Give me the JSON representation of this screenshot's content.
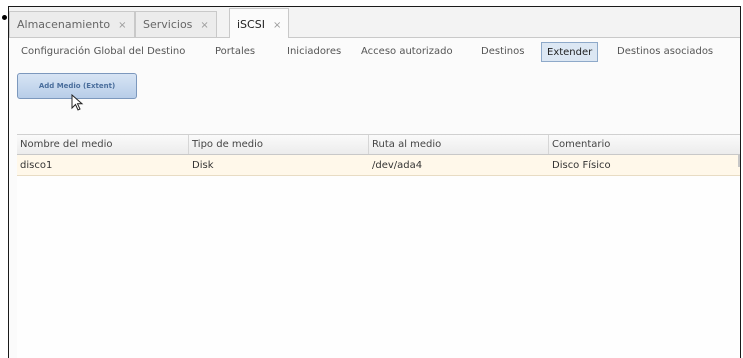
{
  "tabs": [
    {
      "label": "Almacenamiento",
      "close": "×"
    },
    {
      "label": "Servicios",
      "close": "×"
    },
    {
      "label": "iSCSI",
      "close": "×"
    }
  ],
  "subtabs": [
    "Configuración Global del Destino",
    "Portales",
    "Iniciadores",
    "Acceso autorizado",
    "Destinos",
    "Extender",
    "Destinos asociados"
  ],
  "active_subtab": "Extender",
  "add_button_label": "Add Medio (Extent)",
  "table": {
    "columns": [
      "Nombre del medio",
      "Tipo de medio",
      "Ruta al medio",
      "Comentario"
    ],
    "rows": [
      [
        "disco1",
        "Disk",
        "/dev/ada4",
        "Disco Físico"
      ]
    ]
  },
  "icons": {
    "cursor": "mouse-pointer-icon",
    "tab_close": "close-icon"
  }
}
